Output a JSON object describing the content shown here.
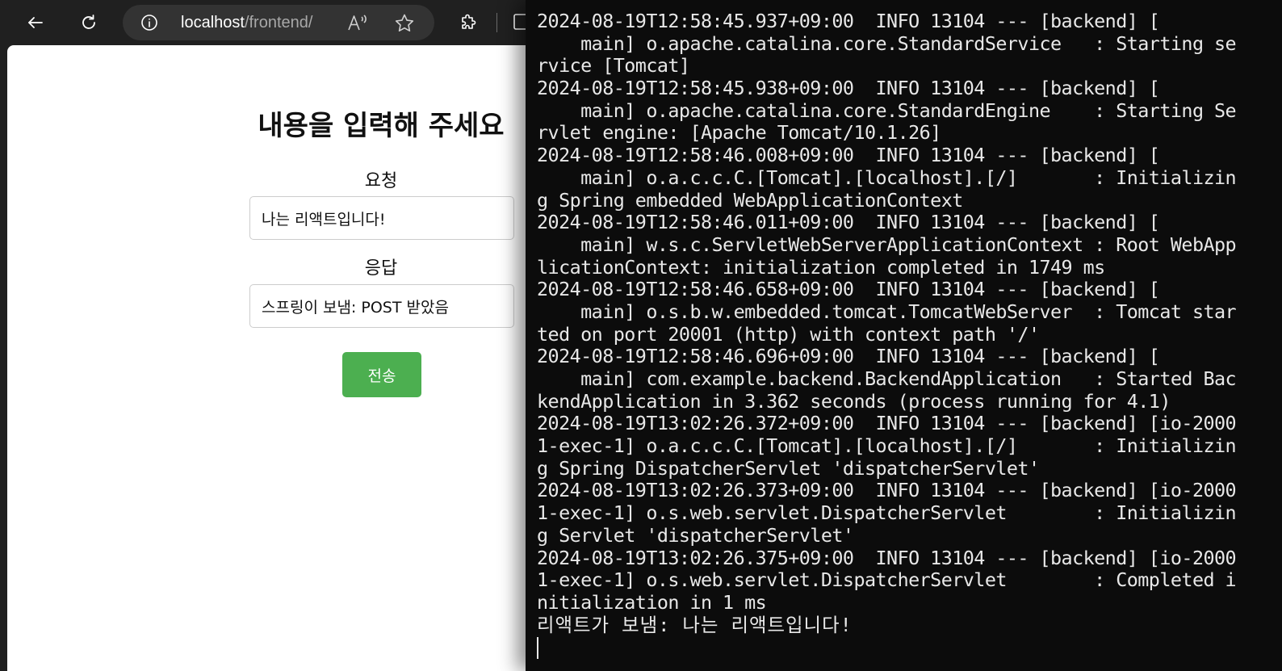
{
  "browser": {
    "url_host": "localhost",
    "url_path": "/frontend/"
  },
  "page": {
    "title": "내용을 입력해 주세요",
    "request_label": "요청",
    "request_value": "나는 리액트입니다!",
    "response_label": "응답",
    "response_value": "스프링이 보냄: POST 받았음",
    "submit_label": "전송"
  },
  "terminal": {
    "lines": [
      "2024-08-19T12:58:45.937+09:00  INFO 13104 --- [backend] [",
      "    main] o.apache.catalina.core.StandardService   : Starting se",
      "rvice [Tomcat]",
      "2024-08-19T12:58:45.938+09:00  INFO 13104 --- [backend] [",
      "    main] o.apache.catalina.core.StandardEngine    : Starting Se",
      "rvlet engine: [Apache Tomcat/10.1.26]",
      "2024-08-19T12:58:46.008+09:00  INFO 13104 --- [backend] [",
      "    main] o.a.c.c.C.[Tomcat].[localhost].[/]       : Initializin",
      "g Spring embedded WebApplicationContext",
      "2024-08-19T12:58:46.011+09:00  INFO 13104 --- [backend] [",
      "    main] w.s.c.ServletWebServerApplicationContext : Root WebApp",
      "licationContext: initialization completed in 1749 ms",
      "2024-08-19T12:58:46.658+09:00  INFO 13104 --- [backend] [",
      "    main] o.s.b.w.embedded.tomcat.TomcatWebServer  : Tomcat star",
      "ted on port 20001 (http) with context path '/'",
      "2024-08-19T12:58:46.696+09:00  INFO 13104 --- [backend] [",
      "    main] com.example.backend.BackendApplication   : Started Bac",
      "kendApplication in 3.362 seconds (process running for 4.1)",
      "2024-08-19T13:02:26.372+09:00  INFO 13104 --- [backend] [io-2000",
      "1-exec-1] o.a.c.c.C.[Tomcat].[localhost].[/]       : Initializin",
      "g Spring DispatcherServlet 'dispatcherServlet'",
      "2024-08-19T13:02:26.373+09:00  INFO 13104 --- [backend] [io-2000",
      "1-exec-1] o.s.web.servlet.DispatcherServlet        : Initializin",
      "g Servlet 'dispatcherServlet'",
      "2024-08-19T13:02:26.375+09:00  INFO 13104 --- [backend] [io-2000",
      "1-exec-1] o.s.web.servlet.DispatcherServlet        : Completed i",
      "nitialization in 1 ms",
      "리액트가 보냄: 나는 리액트입니다!"
    ]
  }
}
